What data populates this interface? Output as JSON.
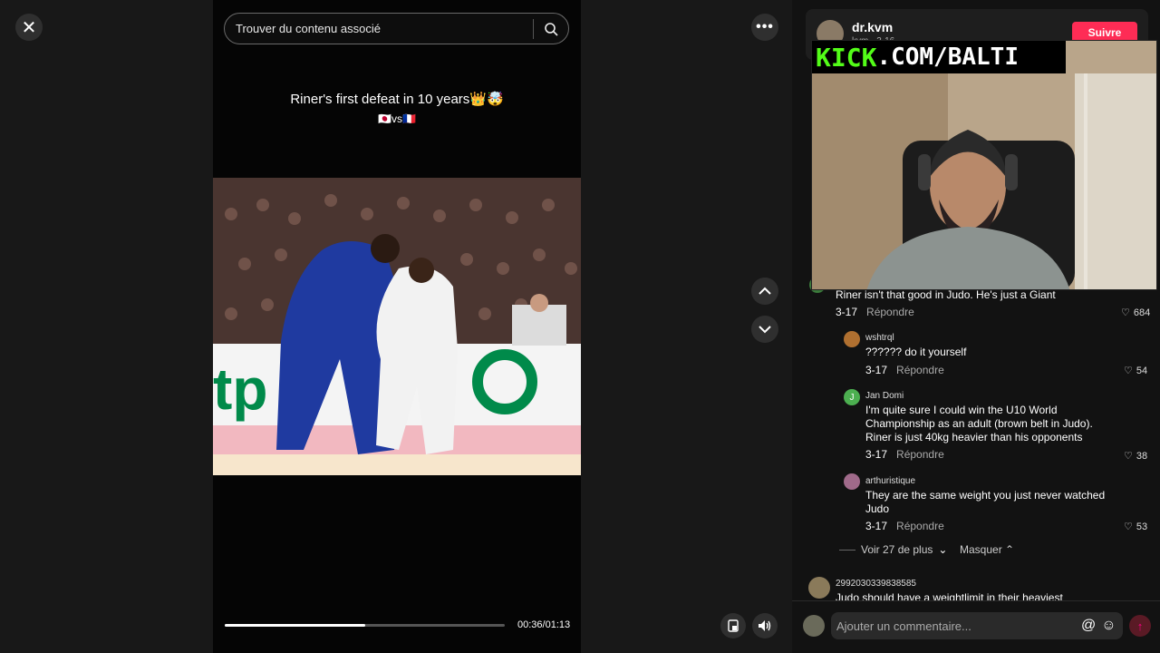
{
  "close_label": "✕",
  "search": {
    "placeholder": "Trouver du contenu associé"
  },
  "caption": {
    "line1": "Riner's first defeat in 10 years👑🤯",
    "line2": "🇯🇵vs🇫🇷"
  },
  "player": {
    "time": "00:36/01:13",
    "progress": 0.5
  },
  "author": {
    "name": "dr.kvm",
    "sub": "kvm · 3-16",
    "follow_label": "Suivre"
  },
  "overlay": {
    "kick_prefix": "KICK",
    "kick_suffix": ".COM/BALTI"
  },
  "comments": [
    {
      "user": "",
      "text": "Riner isn't that good in Judo. He's just a Giant",
      "date": "3-17",
      "reply": "Répondre",
      "likes": "684"
    },
    {
      "user": "wshtrql",
      "text": "?????? do it yourself",
      "date": "3-17",
      "reply": "Répondre",
      "likes": "54"
    },
    {
      "user": "Jan Domi",
      "text": "I'm quite sure I could win the U10 World Championship as an adult (brown belt in Judo). Riner is just 40kg heavier than his opponents",
      "date": "3-17",
      "reply": "Répondre",
      "likes": "38"
    },
    {
      "user": "arthuristique",
      "text": "They are the same weight you just never watched Judo",
      "date": "3-17",
      "reply": "Répondre",
      "likes": "53"
    },
    {
      "user": "2992030339838585",
      "text": "Judo should have a weightlimit in their heaviest",
      "date": "",
      "reply": "",
      "likes": ""
    }
  ],
  "replies_controls": {
    "more": "Voir 27 de plus",
    "hide": "Masquer"
  },
  "comment_input": {
    "placeholder": "Ajouter un commentaire..."
  },
  "colors": {
    "follow": "#fe2c55",
    "kick_green": "#53fc18"
  }
}
